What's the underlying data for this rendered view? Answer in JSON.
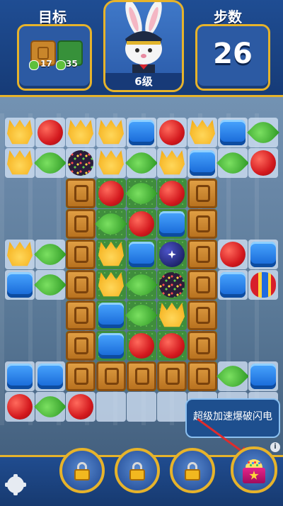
{
  "hud": {
    "goal_label": "目标",
    "moves_label": "步数",
    "moves_value": "26",
    "level_label": "6级",
    "goals": [
      {
        "icon": "wooden-crate-icon",
        "count": "17"
      },
      {
        "icon": "grass-tile-icon",
        "count": "35"
      }
    ]
  },
  "board": {
    "pieces_rows": [
      [
        "tulip",
        "apple",
        "tulip",
        "tulip",
        "cube",
        "apple",
        "tulip",
        "cube",
        "leaf"
      ],
      [
        "tulip",
        "leaf",
        "disco",
        "tulip",
        "leaf",
        "tulip",
        "cube",
        "leaf",
        "apple"
      ],
      [
        "",
        "",
        "crate",
        "apple",
        "leaf",
        "apple",
        "crate",
        "",
        ""
      ],
      [
        "",
        "",
        "crate",
        "leaf",
        "apple",
        "cube",
        "crate",
        "",
        ""
      ],
      [
        "tulip",
        "leaf",
        "crate",
        "tulip",
        "cube",
        "bomb",
        "crate",
        "apple",
        "cube"
      ],
      [
        "cube",
        "leaf",
        "crate",
        "tulip",
        "leaf",
        "disco",
        "crate",
        "cube",
        "rocket"
      ],
      [
        "",
        "",
        "crate",
        "cube",
        "leaf",
        "tulip",
        "crate",
        "",
        ""
      ],
      [
        "",
        "",
        "crate",
        "cube",
        "apple",
        "apple",
        "crate",
        "",
        ""
      ],
      [
        "cube",
        "cube",
        "crate",
        "crate",
        "crate",
        "crate",
        "crate",
        "leaf",
        "cube"
      ],
      [
        "apple",
        "leaf",
        "apple",
        "",
        "",
        "",
        "",
        "",
        ""
      ]
    ]
  },
  "tooltip": {
    "text": "超级加速爆破闪电"
  },
  "info": {
    "label": "i"
  },
  "boosters": [
    {
      "icon": "lock-icon"
    },
    {
      "icon": "lock-icon"
    },
    {
      "icon": "lock-icon"
    },
    {
      "icon": "gift-box-icon"
    }
  ],
  "colors": {
    "hud_blue": "#1f4d93",
    "gold_border": "#e6b32b",
    "tooltip_bg": "#1e4f8e"
  }
}
